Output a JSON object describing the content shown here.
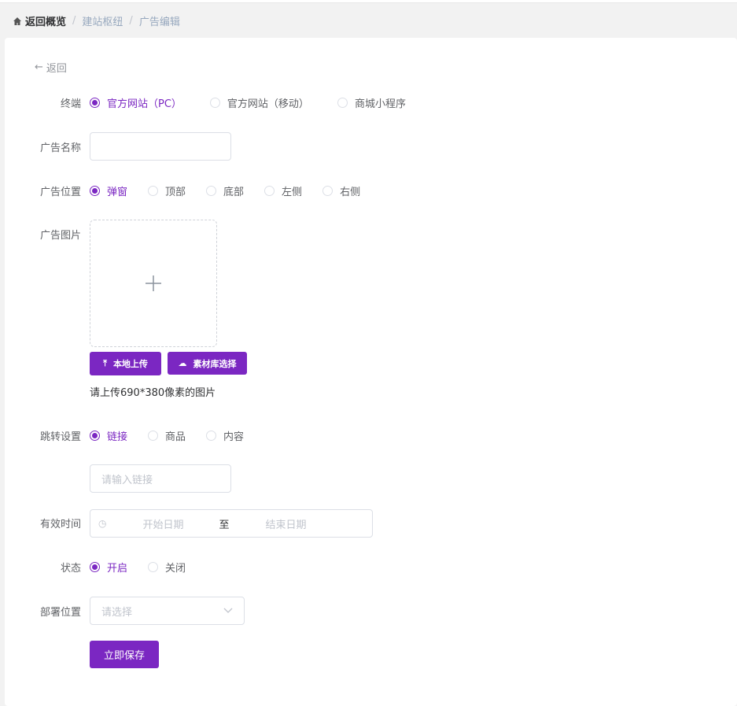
{
  "breadcrumb": {
    "home": "返回概览",
    "items": [
      "建站枢纽",
      "广告编辑"
    ]
  },
  "back_label": "返回",
  "form": {
    "terminal": {
      "label": "终端",
      "options": [
        "官方网站（PC）",
        "官方网站（移动）",
        "商城小程序"
      ],
      "selected": 0
    },
    "ad_name": {
      "label": "广告名称",
      "value": ""
    },
    "ad_position": {
      "label": "广告位置",
      "options": [
        "弹窗",
        "顶部",
        "底部",
        "左侧",
        "右侧"
      ],
      "selected": 0
    },
    "ad_image": {
      "label": "广告图片",
      "upload_local": "本地上传",
      "library_select": "素材库选择",
      "hint": "请上传690*380像素的图片"
    },
    "jump": {
      "label": "跳转设置",
      "options": [
        "链接",
        "商品",
        "内容"
      ],
      "selected": 0,
      "link_placeholder": "请输入链接"
    },
    "valid_time": {
      "label": "有效时间",
      "start_placeholder": "开始日期",
      "separator": "至",
      "end_placeholder": "结束日期"
    },
    "status": {
      "label": "状态",
      "options": [
        "开启",
        "关闭"
      ],
      "selected": 0
    },
    "deploy": {
      "label": "部署位置",
      "placeholder": "请选择"
    },
    "save_label": "立即保存"
  },
  "colors": {
    "accent": "#7b27c2"
  }
}
